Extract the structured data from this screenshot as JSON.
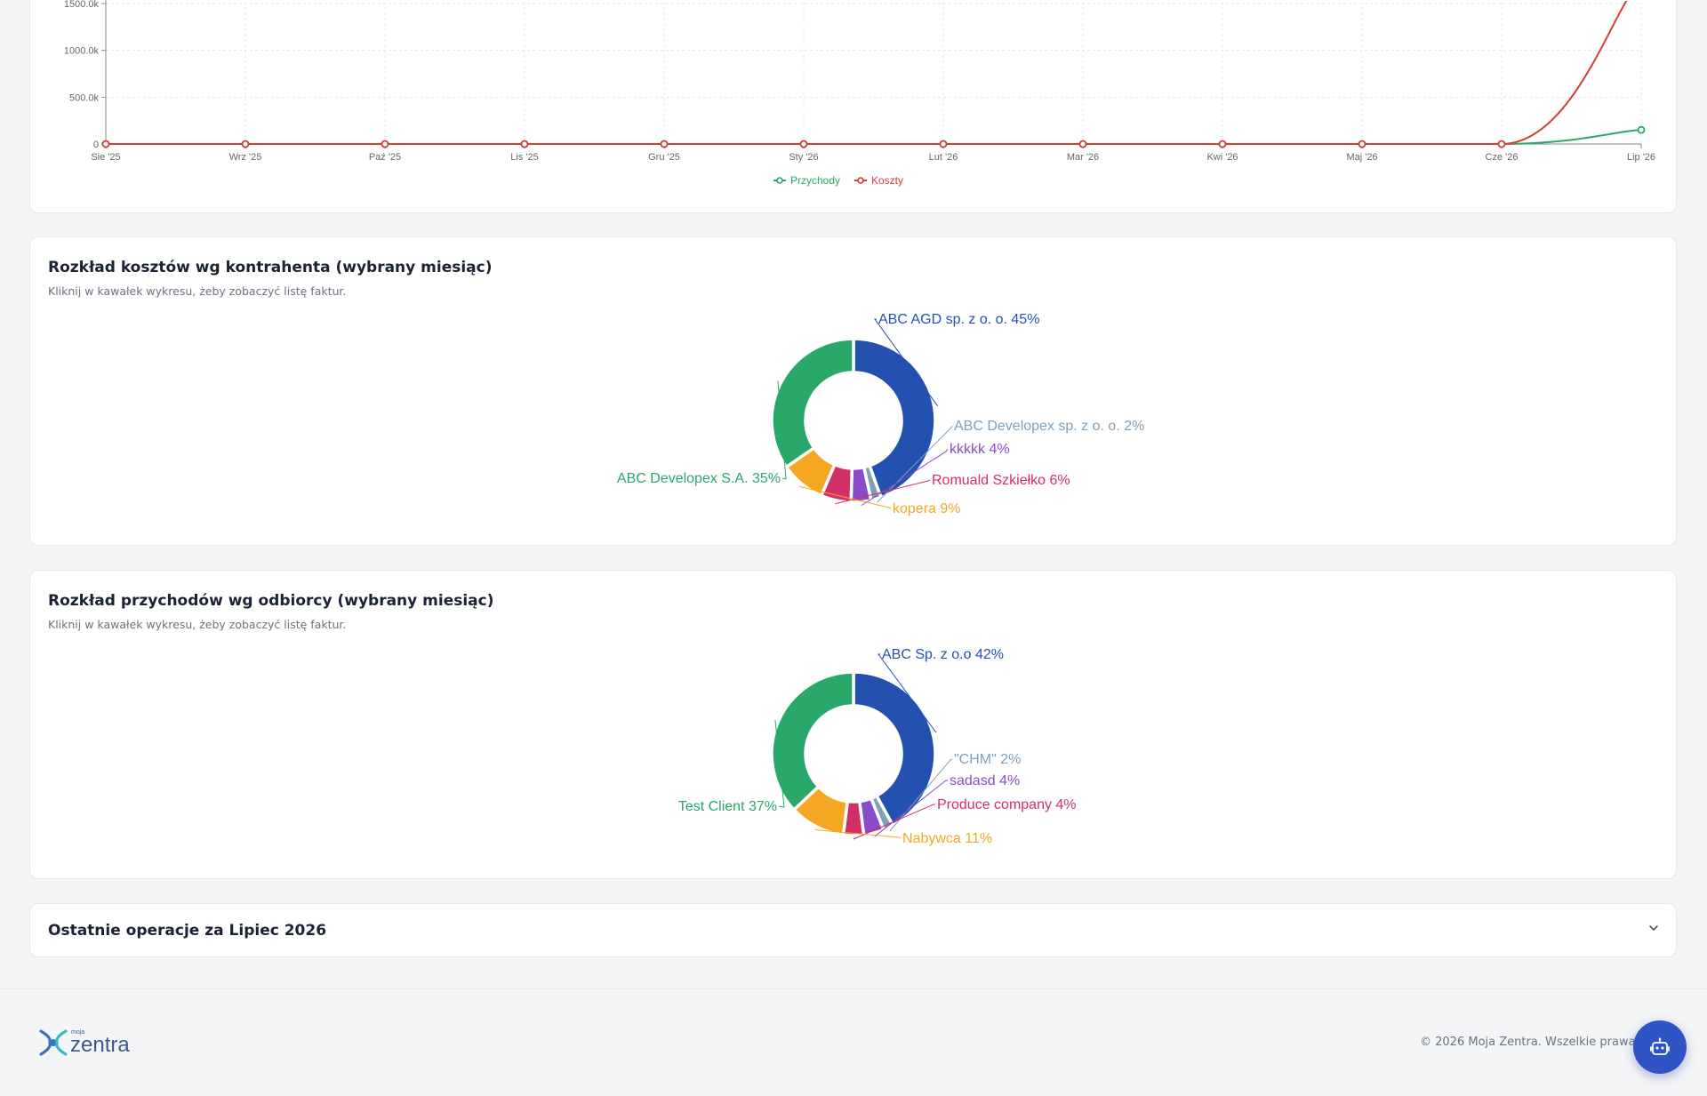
{
  "line_chart": {
    "legend": [
      {
        "label": "Przychody",
        "color": "#2aa86a"
      },
      {
        "label": "Koszty",
        "color": "#d83a3a"
      }
    ]
  },
  "cost_card": {
    "title": "Rozkład kosztów wg kontrahenta (wybrany miesiąc)",
    "subtitle": "Kliknij w kawałek wykresu, żeby zobaczyć listę faktur."
  },
  "revenue_card": {
    "title": "Rozkład przychodów wg odbiorcy (wybrany miesiąc)",
    "subtitle": "Kliknij w kawałek wykresu, żeby zobaczyć listę faktur."
  },
  "operations": {
    "title": "Ostatnie operacje za Lipiec 2026",
    "toggle_icon": "chevron-down-icon"
  },
  "footer": {
    "logo_small": "moja",
    "logo_big": "zentra",
    "copyright": "© 2026 Moja Zentra. Wszelkie prawa zast",
    "bot_icon": "robot-icon"
  },
  "chart_data": [
    {
      "type": "line",
      "x": [
        "Sie '25",
        "Wrz '25",
        "Paź '25",
        "Lis '25",
        "Gru '25",
        "Sty '26",
        "Lut '26",
        "Mar '26",
        "Kwi '26",
        "Maj '26",
        "Cze '26",
        "Lip '26"
      ],
      "y_ticks": [
        "0",
        "500.0k",
        "1000.0k",
        "1500.0k"
      ],
      "ylim": [
        0,
        1500000
      ],
      "series": [
        {
          "name": "Przychody",
          "color": "#2aa86a",
          "values": [
            0,
            0,
            0,
            0,
            0,
            0,
            0,
            0,
            0,
            0,
            0,
            150000
          ]
        },
        {
          "name": "Koszty",
          "color": "#d83a3a",
          "values": [
            0,
            0,
            0,
            0,
            0,
            0,
            0,
            0,
            0,
            0,
            0,
            1700000
          ]
        }
      ],
      "grid": true,
      "legend_position": "bottom-center"
    },
    {
      "type": "pie",
      "donut": true,
      "slices": [
        {
          "label": "ABC AGD sp. z o. o. 45%",
          "value": 45,
          "color": "#2450b0"
        },
        {
          "label": "ABC Developex sp. z o. o. 2%",
          "value": 2,
          "color": "#7fa0b8"
        },
        {
          "label": "kkkkk 4%",
          "value": 4,
          "color": "#8a4bc8"
        },
        {
          "label": "Romuald Szkiełko 6%",
          "value": 6,
          "color": "#d22f67"
        },
        {
          "label": "kopera 9%",
          "value": 9,
          "color": "#f5a623"
        },
        {
          "label": "ABC Developex S.A. 35%",
          "value": 35,
          "color": "#2aa86a"
        }
      ]
    },
    {
      "type": "pie",
      "donut": true,
      "slices": [
        {
          "label": "ABC Sp. z o.o 42%",
          "value": 42,
          "color": "#2450b0"
        },
        {
          "label": "\"CHM\" 2%",
          "value": 2,
          "color": "#7fa0b8"
        },
        {
          "label": "sadasd 4%",
          "value": 4,
          "color": "#8a4bc8"
        },
        {
          "label": "Produce company 4%",
          "value": 4,
          "color": "#d22f67"
        },
        {
          "label": "Nabywca 11%",
          "value": 11,
          "color": "#f5a623"
        },
        {
          "label": "Test Client 37%",
          "value": 37,
          "color": "#2aa86a"
        }
      ]
    }
  ]
}
